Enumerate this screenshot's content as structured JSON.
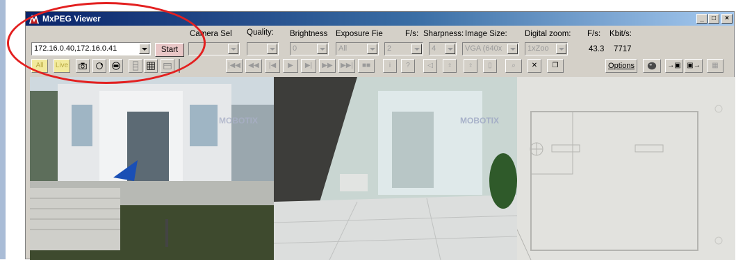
{
  "window": {
    "title": "MxPEG Viewer",
    "min_glyph": "_",
    "max_glyph": "□",
    "close_glyph": "×"
  },
  "address": {
    "value": "172.16.0.40,172.16.0.41"
  },
  "start_label": "Start",
  "labels": {
    "camera_sel": "Camera Sel",
    "quality": "Quality:",
    "brightness": "Brightness",
    "exposure": "Exposure Fie",
    "fs": "F/s:",
    "sharpness": "Sharpness:",
    "image_size": "Image Size:",
    "digital_zoom": "Digital zoom:",
    "fs2": "F/s:",
    "kbits": "Kbit/s:"
  },
  "controls": {
    "camera_sel": "",
    "quality": "",
    "brightness": "0",
    "exposure": "All",
    "fs": "2",
    "sharpness": "4",
    "image_size": "VGA (640x",
    "digital_zoom": "1xZoo"
  },
  "readouts": {
    "fps": "43.3",
    "kbits": "7717"
  },
  "toolbar": {
    "all_label": "All",
    "live_label": "Live",
    "options_label": "Options"
  },
  "colors": {
    "annotation": "#e32020",
    "titlebar": "#0a246a",
    "start_button": "#e8c6c6"
  },
  "views": [
    {
      "watermark": "MOBOTIX"
    },
    {
      "watermark": "MOBOTIX"
    }
  ]
}
